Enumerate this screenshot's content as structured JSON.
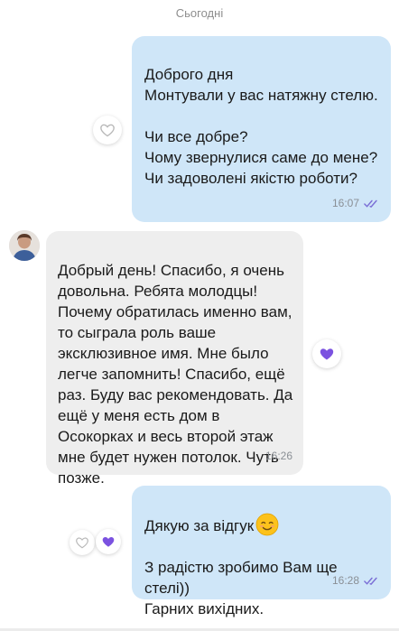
{
  "date_separator": "Сьогодні",
  "messages": [
    {
      "direction": "outgoing",
      "text": "Доброго дня\nМонтували у вас натяжну стелю.\n\nЧи все добре?\nЧому звернулися саме до мене?\nЧи задоволені якістю роботи?",
      "time": "16:07",
      "status": "read",
      "reaction": "empty-heart"
    },
    {
      "direction": "incoming",
      "text": "Добрый день! Спасибо,  я очень довольна.  Ребята молодцы! Почему обратилась именно вам, то сыграла роль ваше эксклюзивное имя.  Мне было легче запомнить! Спасибо,  ещё раз.  Буду вас рекомендовать. Да ещё у меня есть дом в Осокорках и весь второй этаж мне будет нужен потолок.  Чуть позже.",
      "time": "16:26",
      "reaction": "purple-heart"
    },
    {
      "direction": "outgoing",
      "text": "Дякую за відгук",
      "text_emoji": "smiling-face-emoji",
      "text_rest": "З радістю зробимо Вам ще стелі))\nГарних вихідних.",
      "time": "16:28",
      "status": "read",
      "reactions": [
        "empty-heart",
        "purple-heart"
      ]
    }
  ],
  "colors": {
    "outgoing_bubble": "#cfe6f8",
    "incoming_bubble": "#eeeeee",
    "reaction_purple": "#7b52e0",
    "read_ticks": "#7b6fd6"
  }
}
